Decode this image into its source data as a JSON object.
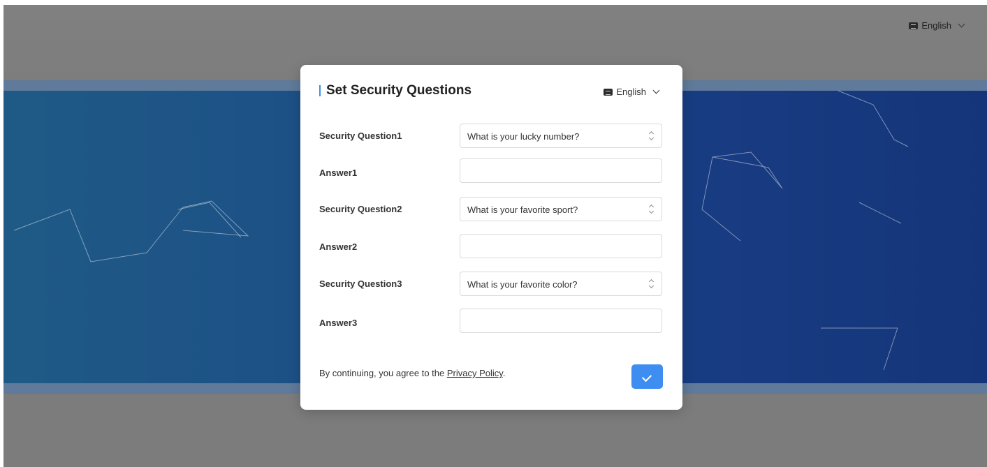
{
  "page_language": {
    "label": "English"
  },
  "modal": {
    "title": "Set Security Questions",
    "language": {
      "label": "English"
    },
    "rows": [
      {
        "label": "Security Question1",
        "type": "select",
        "value": "What is your lucky number?"
      },
      {
        "label": "Answer1",
        "type": "input",
        "value": ""
      },
      {
        "label": "Security Question2",
        "type": "select",
        "value": "What is your favorite sport?"
      },
      {
        "label": "Answer2",
        "type": "input",
        "value": ""
      },
      {
        "label": "Security Question3",
        "type": "select",
        "value": "What is your favorite color?"
      },
      {
        "label": "Answer3",
        "type": "input",
        "value": ""
      }
    ],
    "consent": {
      "prefix": "By continuing, you agree to the ",
      "link": "Privacy Policy",
      "suffix": "."
    }
  },
  "colors": {
    "accent": "#3d8ef0",
    "band": "#1c4f86",
    "overlay": "#7a7a7a"
  }
}
